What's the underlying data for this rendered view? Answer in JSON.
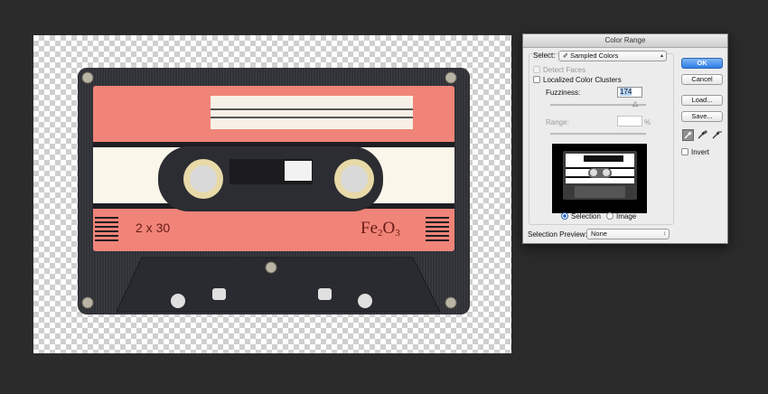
{
  "canvas": {
    "label": {
      "left_text": "2 x 30",
      "right_text_base": "Fe",
      "right_sub1": "2",
      "right_mid": "O",
      "right_sub2": "3"
    }
  },
  "dialog": {
    "title": "Color Range",
    "select_label": "Select:",
    "select_value": "Sampled Colors",
    "select_icon": "eyedropper-icon",
    "detect_faces_label": "Detect Faces",
    "localized_label": "Localized Color Clusters",
    "fuzziness_label": "Fuzziness:",
    "fuzziness_value": "174",
    "range_label": "Range:",
    "range_unit": "%",
    "radio_selection_label": "Selection",
    "radio_image_label": "Image",
    "selection_preview_label": "Selection Preview:",
    "selection_preview_value": "None",
    "buttons": {
      "ok": "OK",
      "cancel": "Cancel",
      "load": "Load...",
      "save": "Save..."
    },
    "invert_label": "Invert",
    "eyedroppers": [
      "eyedropper-icon",
      "eyedropper-plus-icon",
      "eyedropper-minus-icon"
    ]
  },
  "colors": {
    "background": "#2b2b2b",
    "label_salmon": "#f08478",
    "label_cream": "#fbf6ea",
    "shell": "#2d2e33",
    "accent_blue": "#2f7fe6"
  }
}
